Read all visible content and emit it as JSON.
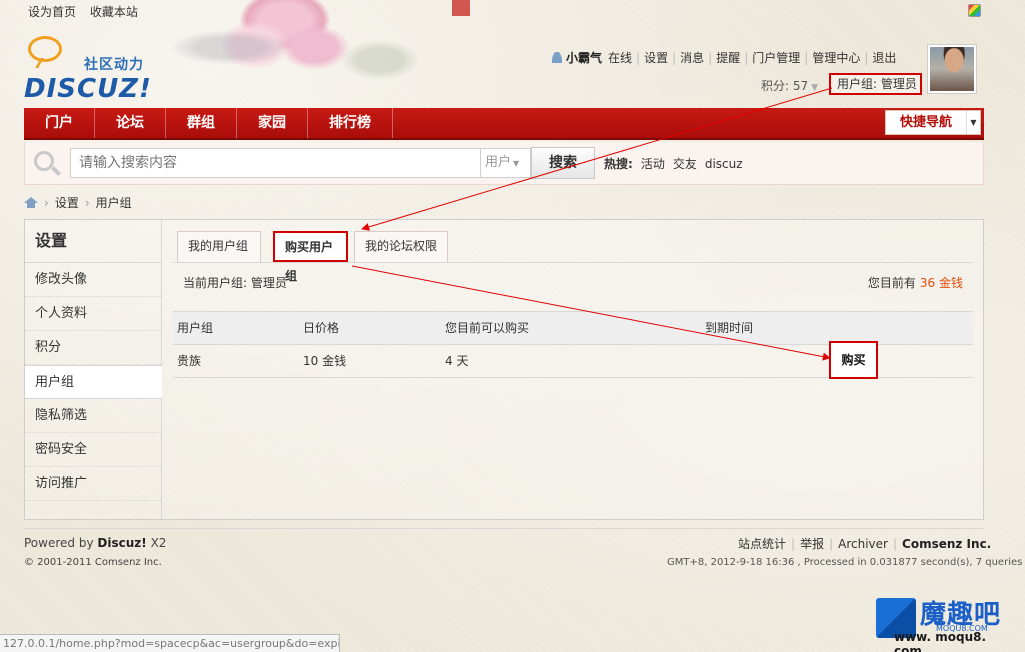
{
  "top_links": [
    "设为首页",
    "收藏本站"
  ],
  "logo": {
    "sub": "社区动力",
    "main": "DISCUZ!"
  },
  "user": {
    "name": "小霸气",
    "links": [
      "在线",
      "设置",
      "消息",
      "提醒",
      "门户管理",
      "管理中心",
      "退出"
    ],
    "credits": "积分: 57",
    "group": "用户组: 管理员"
  },
  "nav": {
    "items": [
      "门户",
      "论坛",
      "群组",
      "家园",
      "排行榜"
    ],
    "quick_nav": "快捷导航"
  },
  "search": {
    "placeholder": "请输入搜索内容",
    "type": "用户",
    "button": "搜索",
    "hot_label": "热搜:",
    "hot_terms": [
      "活动",
      "交友",
      "discuz"
    ]
  },
  "breadcrumb": [
    "设置",
    "用户组"
  ],
  "sidebar": {
    "title": "设置",
    "items": [
      "修改头像",
      "个人资料",
      "积分",
      "用户组",
      "隐私筛选",
      "密码安全",
      "访问推广"
    ],
    "active": "用户组"
  },
  "tabs": [
    "我的用户组",
    "购买用户组",
    "我的论坛权限"
  ],
  "current_tab": "购买用户组",
  "content": {
    "current_group": "当前用户组: 管理员",
    "balance_label": "您目前有",
    "balance_value": "36 金钱"
  },
  "table": {
    "headers": [
      "用户组",
      "日价格",
      "您目前可以购买",
      "到期时间"
    ],
    "rows": [
      {
        "group": "贵族",
        "price": "10 金钱",
        "can_buy": "4 天",
        "action": "购买"
      }
    ]
  },
  "footer": {
    "powered_prefix": "Powered by",
    "powered_brand": "Discuz!",
    "powered_version": "X2",
    "copyright": "© 2001-2011 Comsenz Inc.",
    "links": [
      "站点统计",
      "举报",
      "Archiver"
    ],
    "company": "Comsenz Inc.",
    "time": "GMT+8, 2012-9-18 16:36 , Processed in 0.031877 second(s), 7 queries ."
  },
  "status_url": "127.0.0.1/home.php?mod=spacecp&ac=usergroup&do=expiry",
  "watermark": {
    "name": "魔趣吧",
    "sub": "MOQU8.COM",
    "url": "www. moqu8. com"
  },
  "colors": {
    "nav_red": "#b8120e",
    "highlight_red": "#d10000",
    "coin_orange": "#e44c0c",
    "link_blue": "#1d5aa8"
  }
}
